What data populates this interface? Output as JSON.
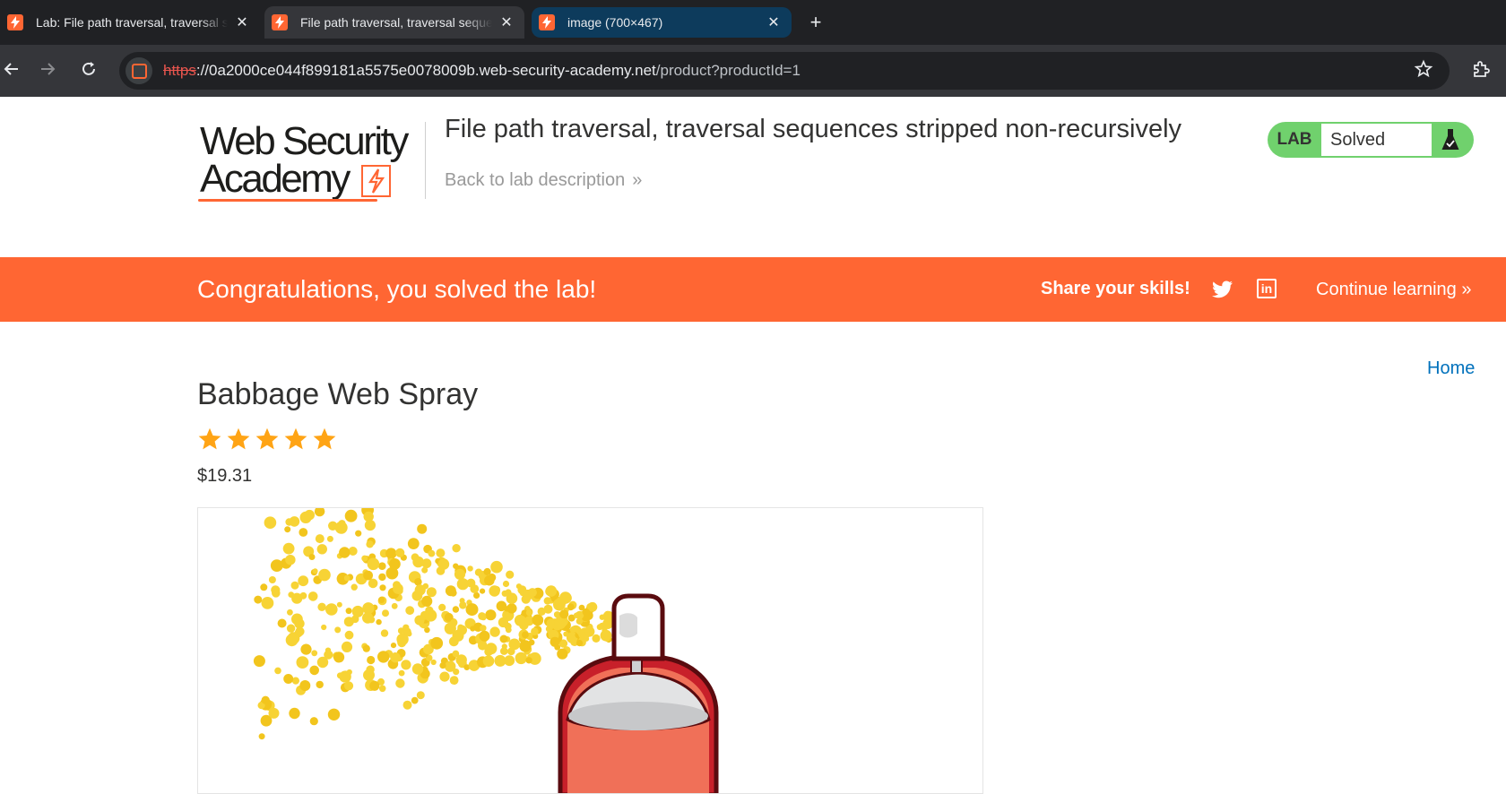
{
  "browser": {
    "tabs": [
      {
        "title": "Lab: File path traversal, traversal sequences stripped non-recursively",
        "active": false
      },
      {
        "title": "File path traversal, traversal sequences stripped non-recursively",
        "active": true
      },
      {
        "title": "image (700×467)",
        "active": false
      }
    ],
    "new_tab": "+",
    "close_glyph": "✕",
    "url": {
      "scheme": "https",
      "host": "://0a2000ce044f899181a5575e0078009b.web-security-academy.net",
      "path": "/product?productId=1"
    }
  },
  "header": {
    "logo_line1": "Web Security",
    "logo_line2": "Academy",
    "lab_title": "File path traversal, traversal sequences stripped non-recursively",
    "back_link": "Back to lab description",
    "back_chevron": "»",
    "badge_label": "LAB",
    "badge_status": "Solved",
    "colors": {
      "accent": "#ff6633",
      "badge_green": "#70d16d",
      "link": "#0071bc"
    }
  },
  "banner": {
    "message": "Congratulations, you solved the lab!",
    "share_label": "Share your skills!",
    "continue_label": "Continue learning",
    "continue_chevron": "»",
    "linkedin_text": "in"
  },
  "nav": {
    "home": "Home"
  },
  "product": {
    "name": "Babbage Web Spray",
    "rating": 5,
    "rating_max": 5,
    "price": "$19.31"
  },
  "icons": [
    "back-arrow-icon",
    "forward-arrow-icon",
    "reload-icon",
    "star-bookmark-icon",
    "extensions-icon",
    "twitter-icon",
    "linkedin-icon",
    "flask-icon",
    "rating-star-icon"
  ]
}
